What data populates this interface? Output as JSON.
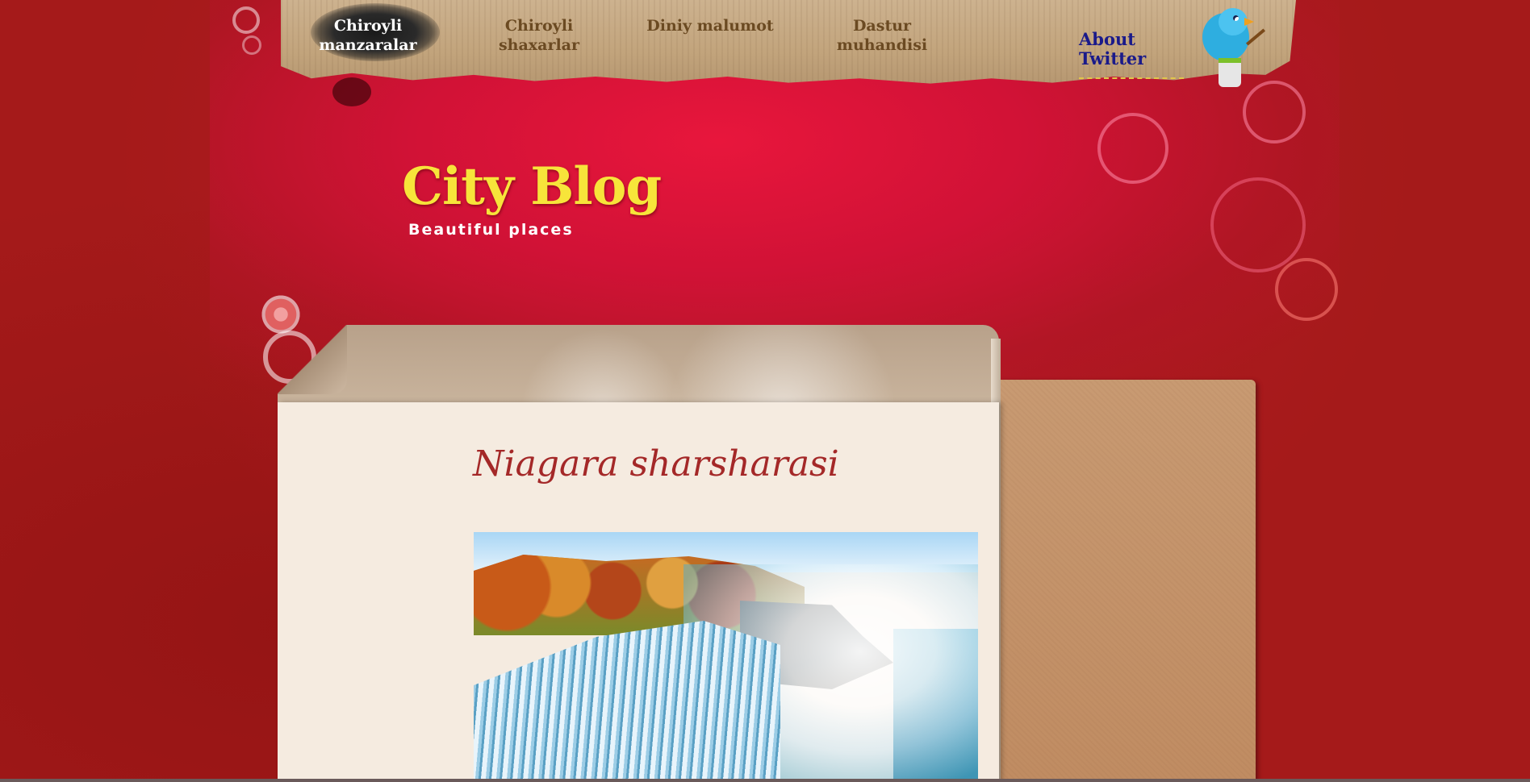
{
  "nav": {
    "items": [
      {
        "label_line1": "Chiroyli",
        "label_line2": "manzaralar",
        "active": true
      },
      {
        "label_line1": "Chiroyli",
        "label_line2": "shaxarlar",
        "active": false
      },
      {
        "label_line1": "Diniy malumot",
        "label_line2": "",
        "active": false
      },
      {
        "label_line1": "Dastur",
        "label_line2": "muhandisi",
        "active": false
      }
    ],
    "twitter_line1": "About",
    "twitter_line2": "Twitter"
  },
  "logo": {
    "title": "City Blog",
    "tagline": "Beautiful places"
  },
  "post": {
    "title": "Niagara sharsharasi"
  },
  "colors": {
    "background": "#a51a1a",
    "header_red": "#d11236",
    "logo_yellow": "#f7e43a",
    "post_title": "#a42828",
    "nav_text": "#6b4a22",
    "twitter_link": "#1a1a8a"
  },
  "icons": [
    "twitter-bird-icon",
    "paint-bucket-icon"
  ]
}
